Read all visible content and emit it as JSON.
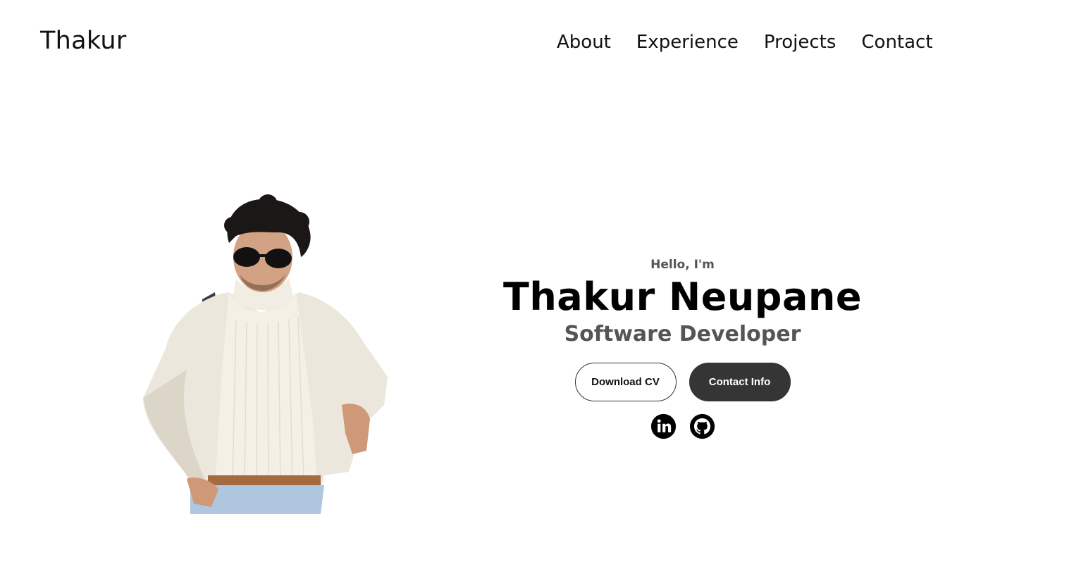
{
  "header": {
    "logo": "Thakur",
    "nav": [
      {
        "label": "About"
      },
      {
        "label": "Experience"
      },
      {
        "label": "Projects"
      },
      {
        "label": "Contact"
      }
    ]
  },
  "hero": {
    "greeting": "Hello, I'm",
    "name": "Thakur Neupane",
    "title": "Software Developer",
    "buttons": {
      "download_cv": "Download CV",
      "contact_info": "Contact Info"
    },
    "socials": [
      {
        "icon": "linkedin-icon"
      },
      {
        "icon": "github-icon"
      }
    ]
  },
  "colors": {
    "text": "#111111",
    "muted": "#555555",
    "button_dark": "#353535",
    "background": "#ffffff"
  }
}
